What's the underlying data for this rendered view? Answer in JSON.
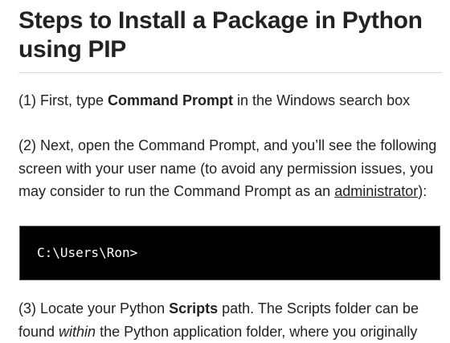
{
  "heading": "Steps to Install a Package in Python using PIP",
  "step1": {
    "prefix": "(1) First, type ",
    "bold": "Command Prompt",
    "suffix": " in the Windows search box"
  },
  "step2": {
    "text": "(2) Next, open the Command Prompt, and you’ll see the following screen with your user name (to avoid any permission issues, you may consider to run the Command Prompt as an ",
    "link": "administrator",
    "suffix": "):"
  },
  "code_block": {
    "text": "C:\\Users\\Ron>"
  },
  "step3": {
    "prefix": "(3) Locate your Python ",
    "bold": "Scripts",
    "middle": " path. The Scripts folder can be found ",
    "italic": "within",
    "suffix": " the Python application folder, where you originally"
  }
}
